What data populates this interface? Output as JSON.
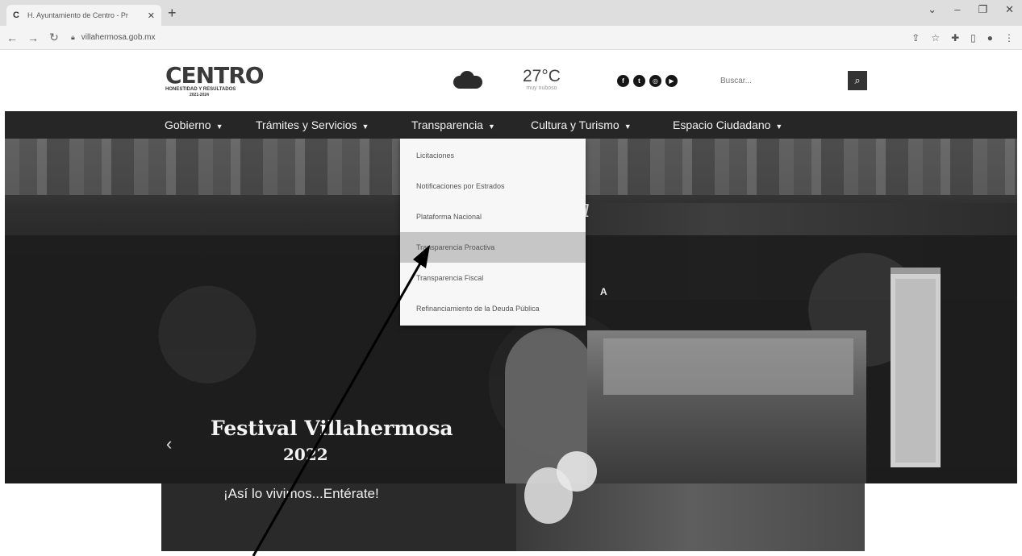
{
  "browser": {
    "tab_title": "H. Ayuntamiento de Centro - Pr",
    "tab_favicon": "C",
    "url": "villahermosa.gob.mx",
    "new_tab_icon": "plus-icon",
    "window_controls": [
      "⌄",
      "–",
      "❐",
      "✕"
    ]
  },
  "header": {
    "logo_title": "CENTRO",
    "logo_subtitle": "HONESTIDAD Y RESULTADOS",
    "logo_years": "2021-2024",
    "weather_icon": "cloud-icon",
    "temperature": "27°C",
    "weather_condition": "muy nuboso",
    "social_icons": [
      "facebook-icon",
      "twitter-icon",
      "instagram-icon",
      "youtube-icon"
    ],
    "search_placeholder": "Buscar...",
    "search_icon": "search-icon"
  },
  "nav": {
    "items": [
      {
        "label": "Gobierno"
      },
      {
        "label": "Trámites y Servicios"
      },
      {
        "label": "Transparencia"
      },
      {
        "label": "Cultura y Turismo"
      },
      {
        "label": "Espacio Ciudadano"
      }
    ]
  },
  "dropdown": {
    "parent": "Transparencia",
    "active_index": 3,
    "items": [
      {
        "label": "Licitaciones"
      },
      {
        "label": "Notificaciones por Estrados"
      },
      {
        "label": "Plataforma Nacional"
      },
      {
        "label": "Transparencia Proactiva"
      },
      {
        "label": "Transparencia Fiscal"
      },
      {
        "label": "Refinanciamiento de la Deuda Pública"
      }
    ]
  },
  "hero": {
    "script_text": "a",
    "partial_letter": "A",
    "slide_title": "Festival Villahermosa",
    "slide_year": "2022",
    "caption": "¡Así lo vivimos...Entérate!",
    "prev_icon": "chevron-left-icon"
  },
  "colors": {
    "navbar": "#262626",
    "dropdown_bg": "#f7f7f7",
    "dropdown_active": "#c6c6c6",
    "search_button": "#333333"
  }
}
